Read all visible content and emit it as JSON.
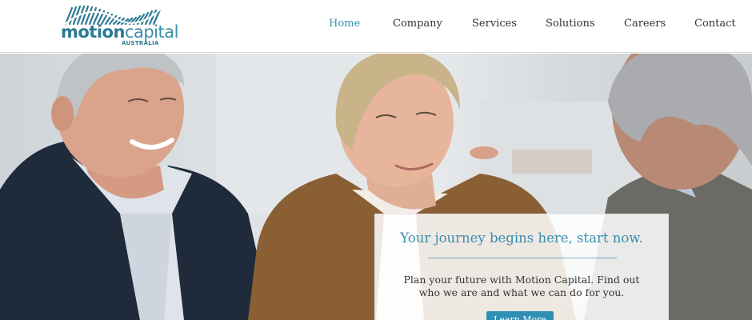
{
  "brand": {
    "name_part1": "motion",
    "name_part2": "capital",
    "subtitle": "AUSTRALIA",
    "accent_color": "#3a8fb0"
  },
  "nav": {
    "items": [
      {
        "label": "Home",
        "active": true
      },
      {
        "label": "Company",
        "active": false
      },
      {
        "label": "Services",
        "active": false
      },
      {
        "label": "Solutions",
        "active": false
      },
      {
        "label": "Careers",
        "active": false
      },
      {
        "label": "Contact",
        "active": false
      }
    ]
  },
  "hero": {
    "image_subject": "hero-photo",
    "card": {
      "title": "Your journey begins here, start now.",
      "body_line1": "Plan your future with Motion Capital. Find out",
      "body_line2": "who we are and what we can do for you.",
      "button_label": "Learn More",
      "button_color": "#2f8fb5"
    }
  }
}
